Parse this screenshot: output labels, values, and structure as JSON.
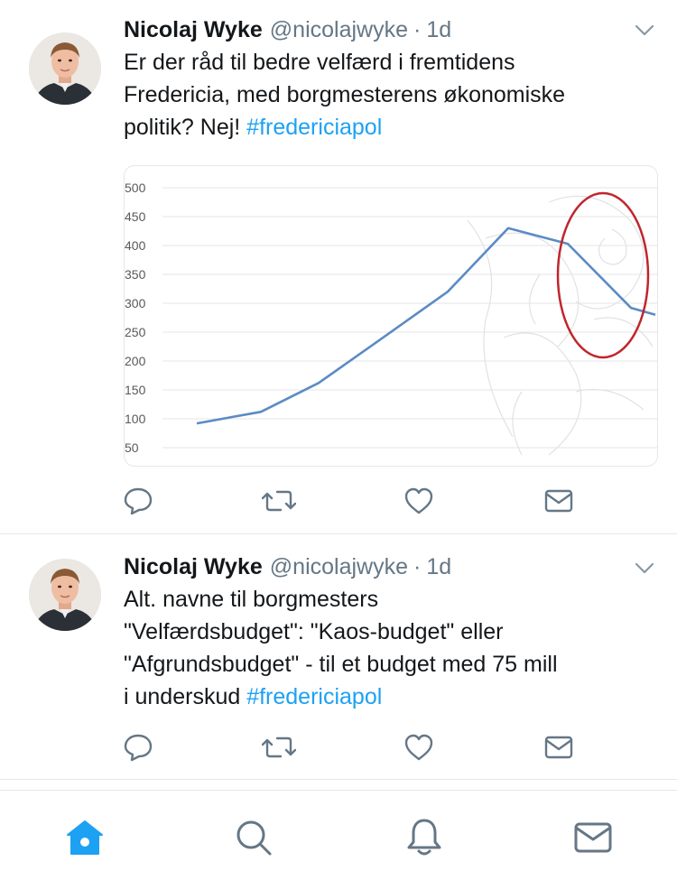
{
  "colors": {
    "text": "#14171a",
    "secondary": "#657786",
    "link": "#1da1f2",
    "divider": "#e1e8ed",
    "icon": "#657786",
    "tab_active": "#1da1f2",
    "chart_line": "#5b8bc4",
    "annotation_circle": "#c0262d"
  },
  "tweets": [
    {
      "author_name": "Nicolaj Wyke",
      "handle": "@nicolajwyke",
      "separator": "·",
      "time": "1d",
      "text_lines": [
        "Er der råd til bedre velfærd i fremtidens",
        "Fredericia, med borgmesterens økonomiske"
      ],
      "text_last_line": "politik? Nej! ",
      "hashtag": "#fredericiapol",
      "icons": [
        "reply-icon",
        "retweet-icon",
        "like-icon",
        "dm-icon"
      ]
    },
    {
      "author_name": "Nicolaj Wyke",
      "handle": "@nicolajwyke",
      "separator": "·",
      "time": "1d",
      "text_lines": [
        "Alt. navne til borgmesters",
        "\"Velfærdsbudget\": \"Kaos-budget\" eller",
        "\"Afgrundsbudget\" - til et budget med 75 mill"
      ],
      "text_last_line": "i underskud ",
      "hashtag": "#fredericiapol",
      "icons": [
        "reply-icon",
        "retweet-icon",
        "like-icon",
        "dm-icon"
      ]
    }
  ],
  "tabbar": {
    "icons": [
      "home-icon",
      "search-icon",
      "notifications-icon",
      "messages-icon"
    ],
    "active": "home-icon"
  },
  "chart_data": {
    "type": "line",
    "x": [
      1,
      2,
      3,
      4,
      5,
      6,
      7,
      8,
      9,
      10
    ],
    "series": [
      {
        "values": [
          92,
          112,
          162,
          238,
          320,
          430,
          403,
          292,
          280
        ]
      }
    ],
    "yticks": [
      "500",
      "450",
      "400",
      "350",
      "300",
      "250",
      "200",
      "150",
      "100",
      "50"
    ],
    "ylim": [
      50,
      500
    ],
    "grid": true,
    "annotation": "red-ellipse-around-decline"
  }
}
